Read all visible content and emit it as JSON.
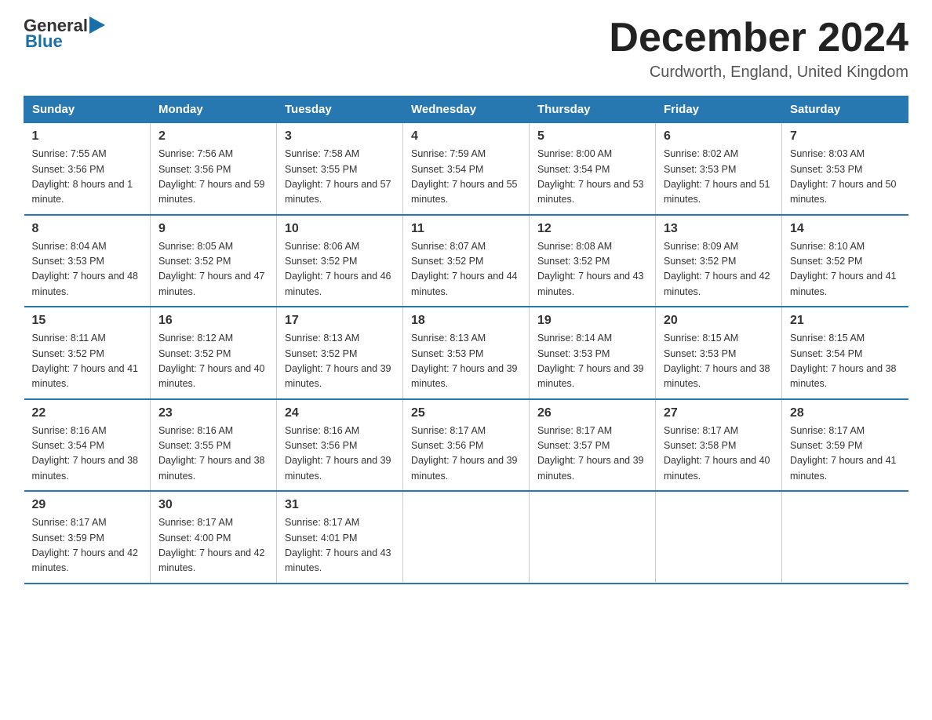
{
  "header": {
    "logo_general": "General",
    "logo_blue": "Blue",
    "month_title": "December 2024",
    "location": "Curdworth, England, United Kingdom"
  },
  "weekdays": [
    "Sunday",
    "Monday",
    "Tuesday",
    "Wednesday",
    "Thursday",
    "Friday",
    "Saturday"
  ],
  "weeks": [
    [
      {
        "day": "1",
        "sunrise": "7:55 AM",
        "sunset": "3:56 PM",
        "daylight": "8 hours and 1 minute."
      },
      {
        "day": "2",
        "sunrise": "7:56 AM",
        "sunset": "3:56 PM",
        "daylight": "7 hours and 59 minutes."
      },
      {
        "day": "3",
        "sunrise": "7:58 AM",
        "sunset": "3:55 PM",
        "daylight": "7 hours and 57 minutes."
      },
      {
        "day": "4",
        "sunrise": "7:59 AM",
        "sunset": "3:54 PM",
        "daylight": "7 hours and 55 minutes."
      },
      {
        "day": "5",
        "sunrise": "8:00 AM",
        "sunset": "3:54 PM",
        "daylight": "7 hours and 53 minutes."
      },
      {
        "day": "6",
        "sunrise": "8:02 AM",
        "sunset": "3:53 PM",
        "daylight": "7 hours and 51 minutes."
      },
      {
        "day": "7",
        "sunrise": "8:03 AM",
        "sunset": "3:53 PM",
        "daylight": "7 hours and 50 minutes."
      }
    ],
    [
      {
        "day": "8",
        "sunrise": "8:04 AM",
        "sunset": "3:53 PM",
        "daylight": "7 hours and 48 minutes."
      },
      {
        "day": "9",
        "sunrise": "8:05 AM",
        "sunset": "3:52 PM",
        "daylight": "7 hours and 47 minutes."
      },
      {
        "day": "10",
        "sunrise": "8:06 AM",
        "sunset": "3:52 PM",
        "daylight": "7 hours and 46 minutes."
      },
      {
        "day": "11",
        "sunrise": "8:07 AM",
        "sunset": "3:52 PM",
        "daylight": "7 hours and 44 minutes."
      },
      {
        "day": "12",
        "sunrise": "8:08 AM",
        "sunset": "3:52 PM",
        "daylight": "7 hours and 43 minutes."
      },
      {
        "day": "13",
        "sunrise": "8:09 AM",
        "sunset": "3:52 PM",
        "daylight": "7 hours and 42 minutes."
      },
      {
        "day": "14",
        "sunrise": "8:10 AM",
        "sunset": "3:52 PM",
        "daylight": "7 hours and 41 minutes."
      }
    ],
    [
      {
        "day": "15",
        "sunrise": "8:11 AM",
        "sunset": "3:52 PM",
        "daylight": "7 hours and 41 minutes."
      },
      {
        "day": "16",
        "sunrise": "8:12 AM",
        "sunset": "3:52 PM",
        "daylight": "7 hours and 40 minutes."
      },
      {
        "day": "17",
        "sunrise": "8:13 AM",
        "sunset": "3:52 PM",
        "daylight": "7 hours and 39 minutes."
      },
      {
        "day": "18",
        "sunrise": "8:13 AM",
        "sunset": "3:53 PM",
        "daylight": "7 hours and 39 minutes."
      },
      {
        "day": "19",
        "sunrise": "8:14 AM",
        "sunset": "3:53 PM",
        "daylight": "7 hours and 39 minutes."
      },
      {
        "day": "20",
        "sunrise": "8:15 AM",
        "sunset": "3:53 PM",
        "daylight": "7 hours and 38 minutes."
      },
      {
        "day": "21",
        "sunrise": "8:15 AM",
        "sunset": "3:54 PM",
        "daylight": "7 hours and 38 minutes."
      }
    ],
    [
      {
        "day": "22",
        "sunrise": "8:16 AM",
        "sunset": "3:54 PM",
        "daylight": "7 hours and 38 minutes."
      },
      {
        "day": "23",
        "sunrise": "8:16 AM",
        "sunset": "3:55 PM",
        "daylight": "7 hours and 38 minutes."
      },
      {
        "day": "24",
        "sunrise": "8:16 AM",
        "sunset": "3:56 PM",
        "daylight": "7 hours and 39 minutes."
      },
      {
        "day": "25",
        "sunrise": "8:17 AM",
        "sunset": "3:56 PM",
        "daylight": "7 hours and 39 minutes."
      },
      {
        "day": "26",
        "sunrise": "8:17 AM",
        "sunset": "3:57 PM",
        "daylight": "7 hours and 39 minutes."
      },
      {
        "day": "27",
        "sunrise": "8:17 AM",
        "sunset": "3:58 PM",
        "daylight": "7 hours and 40 minutes."
      },
      {
        "day": "28",
        "sunrise": "8:17 AM",
        "sunset": "3:59 PM",
        "daylight": "7 hours and 41 minutes."
      }
    ],
    [
      {
        "day": "29",
        "sunrise": "8:17 AM",
        "sunset": "3:59 PM",
        "daylight": "7 hours and 42 minutes."
      },
      {
        "day": "30",
        "sunrise": "8:17 AM",
        "sunset": "4:00 PM",
        "daylight": "7 hours and 42 minutes."
      },
      {
        "day": "31",
        "sunrise": "8:17 AM",
        "sunset": "4:01 PM",
        "daylight": "7 hours and 43 minutes."
      },
      null,
      null,
      null,
      null
    ]
  ],
  "labels": {
    "sunrise": "Sunrise:",
    "sunset": "Sunset:",
    "daylight": "Daylight:"
  }
}
